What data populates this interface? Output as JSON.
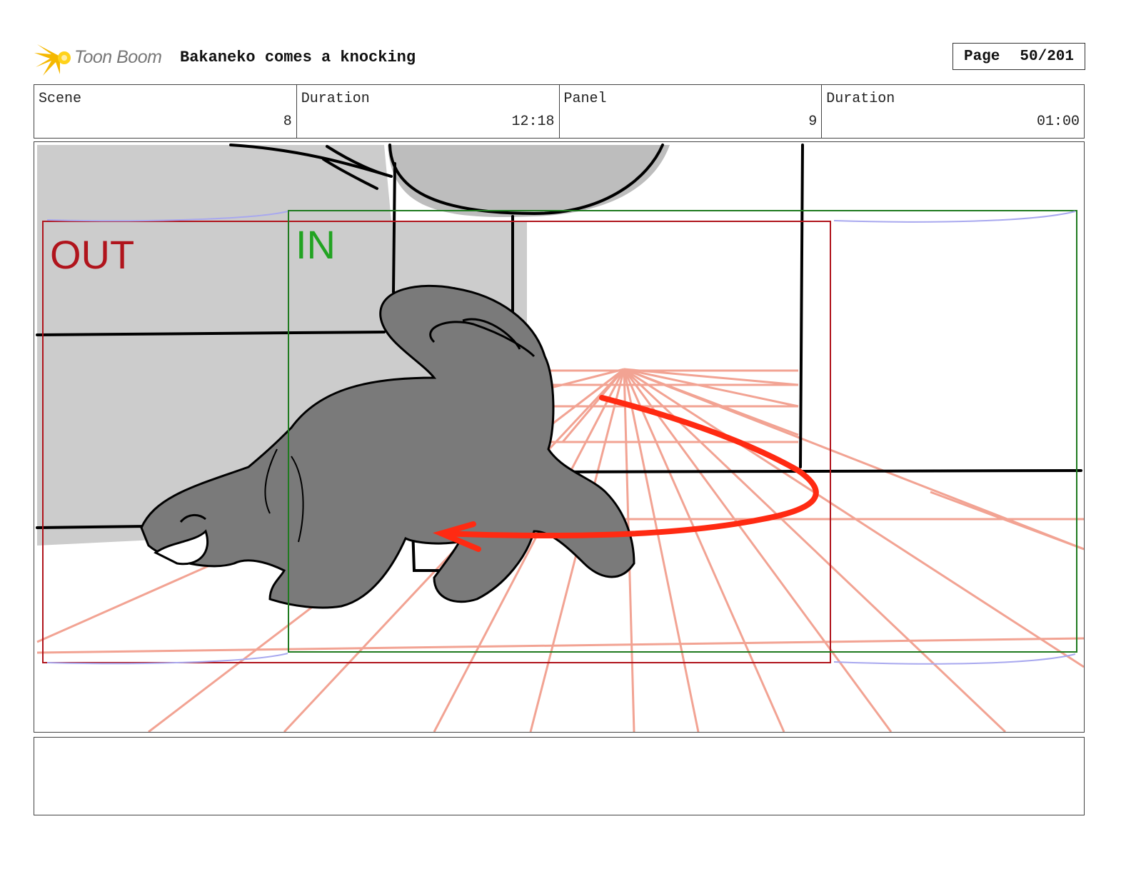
{
  "app": {
    "logo_text": "Toon Boom"
  },
  "header": {
    "project_title": "Bakaneko comes a knocking",
    "page_label": "Page",
    "page_value": "50/201"
  },
  "info": [
    {
      "label": "Scene",
      "value": "8"
    },
    {
      "label": "Duration",
      "value": "12:18"
    },
    {
      "label": "Panel",
      "value": "9"
    },
    {
      "label": "Duration",
      "value": "01:00"
    }
  ],
  "panel": {
    "out_label": "OUT",
    "in_label": "IN",
    "colors": {
      "out_frame": "#b0141c",
      "in_frame": "#1f7a1f",
      "perspective": "#f2a393",
      "motion_arrow": "#ff2a12",
      "cat_fill": "#7a7a7a",
      "wall_fill": "#cccccc"
    }
  },
  "notes": {
    "text": ""
  }
}
